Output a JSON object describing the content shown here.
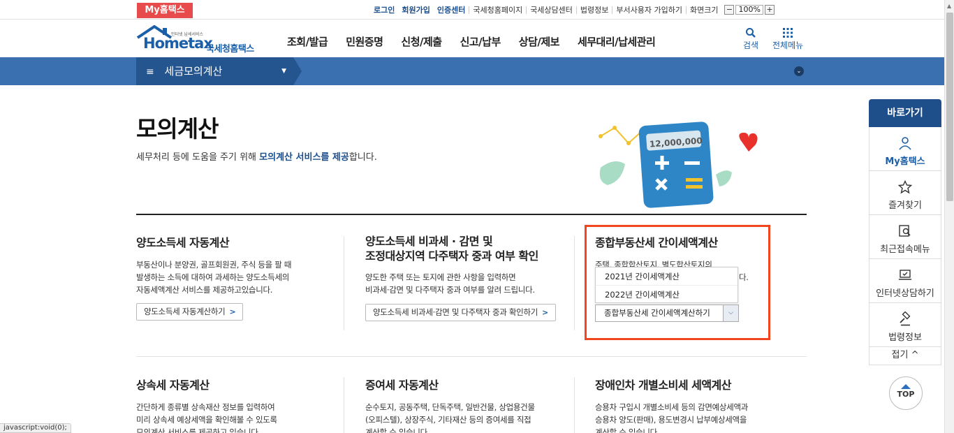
{
  "util": {
    "my_hometax": "My홈택스",
    "login": "로그인",
    "join": "회원가입",
    "cert": "인증센터",
    "links": [
      "국세청홈페이지",
      "국세상담센터",
      "법령정보",
      "부서사용자 가입하기",
      "화면크기"
    ],
    "zoom_minus": "−",
    "zoom_value": "100%",
    "zoom_plus": "+"
  },
  "logo": {
    "tiny": "인터넷 납세서비스",
    "brand": "Hometax",
    "name": "국세청홈택스"
  },
  "gnb": {
    "menu": [
      "조회/발급",
      "민원증명",
      "신청/제출",
      "신고/납부",
      "상담/제보",
      "세무대리/납세관리"
    ],
    "search": "검색",
    "all_menu": "전체메뉴"
  },
  "band": {
    "title": "세금모의계산",
    "ham": "≡",
    "caret": "▼",
    "down": "⌄"
  },
  "page": {
    "title": "모의계산",
    "desc_pre": "세무처리 등에 도움을 주기 위해 ",
    "desc_hl": "모의계산 서비스를 제공",
    "desc_post": "합니다.",
    "hero_amount": "12,000,000"
  },
  "cards": [
    {
      "title": "양도소득세 자동계산",
      "desc": [
        "부동산이나 분양권, 골프회원권, 주식 등을 팔 때",
        "발생하는 소득에 대하여 과세하는 양도소득세의",
        "자동세액계산 서비스를 제공하고있습니다."
      ],
      "button": "양도소득세 자동계산하기"
    },
    {
      "title1": "양도소득세 비과세 · 감면 및",
      "title2": "조정대상지역 다주택자 중과 여부 확인",
      "desc": [
        "양도한 주택 또는 토지에 관한 사항을 입력하면",
        "비과세·감면 및 다주택자 중과 여부를 알려 드립니다."
      ],
      "button": "양도소득세 비과세·감면 및 다주택자 중과 확인하기"
    },
    {
      "title": "종합부동산세 간이세액계산",
      "desc": [
        "주택, 종합합산토지, 별도합산토지의",
        "다."
      ],
      "options": [
        "2021년 간이세액계산",
        "2022년 간이세액계산"
      ],
      "select": "종합부동산세 간이세액계산하기"
    },
    {
      "title": "상속세 자동계산",
      "desc": [
        "간단하게 종류별 상속재산 정보를 입력하여",
        "미리 상속세 예상세액을 확인해볼 수 있도록",
        "모의계산 서비스를 제공하고 있습니다."
      ]
    },
    {
      "title": "증여세 자동계산",
      "desc": [
        "순수토지, 공동주택, 단독주택, 일반건물, 상업용건물",
        "(오피스텔), 상장주식, 기타재산 등의 증여세를 직접",
        "계산할 수 있습니다."
      ]
    },
    {
      "title": "장애인차 개별소비세 세액계산",
      "desc": [
        "승용차 구입시 개별소비세 등의 감면예상세액과",
        "승용차 양도(판매), 용도변경시 납부예상세액을",
        "계산할 수 있습니다."
      ]
    }
  ],
  "quick": {
    "head": "바로가기",
    "items": [
      "My홈택스",
      "즐겨찾기",
      "최근접속메뉴",
      "인터넷상담하기",
      "법령정보"
    ],
    "fold": "접기 ^",
    "top": "TOP"
  },
  "status": "javascript:void(0);",
  "colors": {
    "brand": "#1b5fa8",
    "band": "#3a6fb0",
    "highlight": "#f0451e",
    "my_badge": "#e84b4b"
  }
}
